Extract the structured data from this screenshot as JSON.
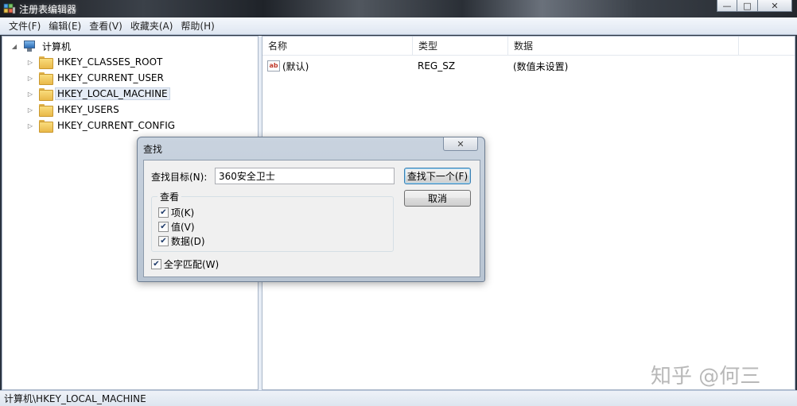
{
  "window": {
    "title": "注册表编辑器",
    "controls": {
      "minimize": "—",
      "maximize": "□",
      "close": "✕"
    }
  },
  "menu": [
    "文件(F)",
    "编辑(E)",
    "查看(V)",
    "收藏夹(A)",
    "帮助(H)"
  ],
  "tree": {
    "root": "计算机",
    "keys": [
      {
        "label": "HKEY_CLASSES_ROOT",
        "selected": false
      },
      {
        "label": "HKEY_CURRENT_USER",
        "selected": false
      },
      {
        "label": "HKEY_LOCAL_MACHINE",
        "selected": true
      },
      {
        "label": "HKEY_USERS",
        "selected": false
      },
      {
        "label": "HKEY_CURRENT_CONFIG",
        "selected": false
      }
    ]
  },
  "list": {
    "columns": [
      "名称",
      "类型",
      "数据"
    ],
    "rows": [
      {
        "name": "(默认)",
        "type": "REG_SZ",
        "data": "(数值未设置)",
        "icon": "string-value-icon"
      }
    ]
  },
  "status_bar": "计算机\\HKEY_LOCAL_MACHINE",
  "find_dialog": {
    "title": "查找",
    "close": "✕",
    "target_label": "查找目标(N):",
    "target_value": "360安全卫士",
    "find_next_button": "查找下一个(F)",
    "cancel_button": "取消",
    "look_at_group": "查看",
    "checkboxes": [
      {
        "label": "项(K)",
        "checked": true
      },
      {
        "label": "值(V)",
        "checked": true
      },
      {
        "label": "数据(D)",
        "checked": true
      }
    ],
    "match_whole": {
      "label": "全字匹配(W)",
      "checked": true
    }
  },
  "watermark": "知乎 @何三"
}
